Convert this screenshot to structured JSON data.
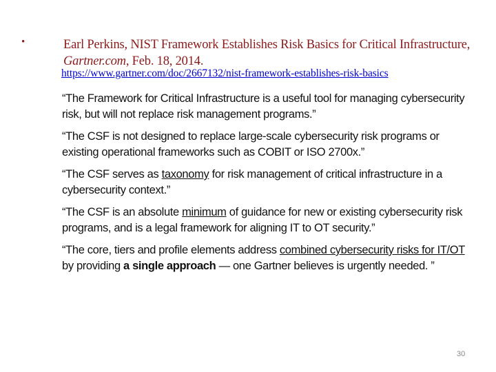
{
  "citation": {
    "bullet": "•",
    "author_title": "Earl Perkins, NIST Framework Establishes Risk Basics for Critical Infrastructure, ",
    "source": "Gartner.com",
    "date": ", Feb. 18, 2014.",
    "url": "https://www.gartner.com/doc/2667132/nist-framework-establishes-risk-basics"
  },
  "quotes": [
    {
      "parts": [
        {
          "text": "“The Framework for Critical Infrastructure is a useful tool for managing cybersecurity risk, but will not replace risk management programs.”",
          "style": "plain"
        }
      ]
    },
    {
      "parts": [
        {
          "text": "“The CSF is not designed to replace large-scale cybersecurity risk programs or existing operational frameworks such as COBIT or ISO 2700x.”",
          "style": "plain"
        }
      ]
    },
    {
      "parts": [
        {
          "text": "“The CSF serves as ",
          "style": "plain"
        },
        {
          "text": "taxonomy",
          "style": "underline"
        },
        {
          "text": " for risk management of critical infrastructure in a cybersecurity context.”",
          "style": "plain"
        }
      ]
    },
    {
      "parts": [
        {
          "text": "“The CSF is an absolute ",
          "style": "plain"
        },
        {
          "text": "minimum",
          "style": "underline"
        },
        {
          "text": " of guidance for new or existing cybersecurity risk programs, and is a legal framework for aligning IT to OT security.”",
          "style": "plain"
        }
      ]
    },
    {
      "parts": [
        {
          "text": "“The core, tiers and profile elements address ",
          "style": "plain"
        },
        {
          "text": "combined cybersecurity risks for IT/OT",
          "style": "underline"
        },
        {
          "text": " by providing ",
          "style": "plain"
        },
        {
          "text": "a single approach",
          "style": "bold"
        },
        {
          "text": " — one Gartner believes is urgently needed. ”",
          "style": "plain"
        }
      ]
    }
  ],
  "page_number": "30",
  "colors": {
    "citation_text": "#8b1a1a",
    "link": "#0000cc",
    "body_text": "#111111"
  }
}
